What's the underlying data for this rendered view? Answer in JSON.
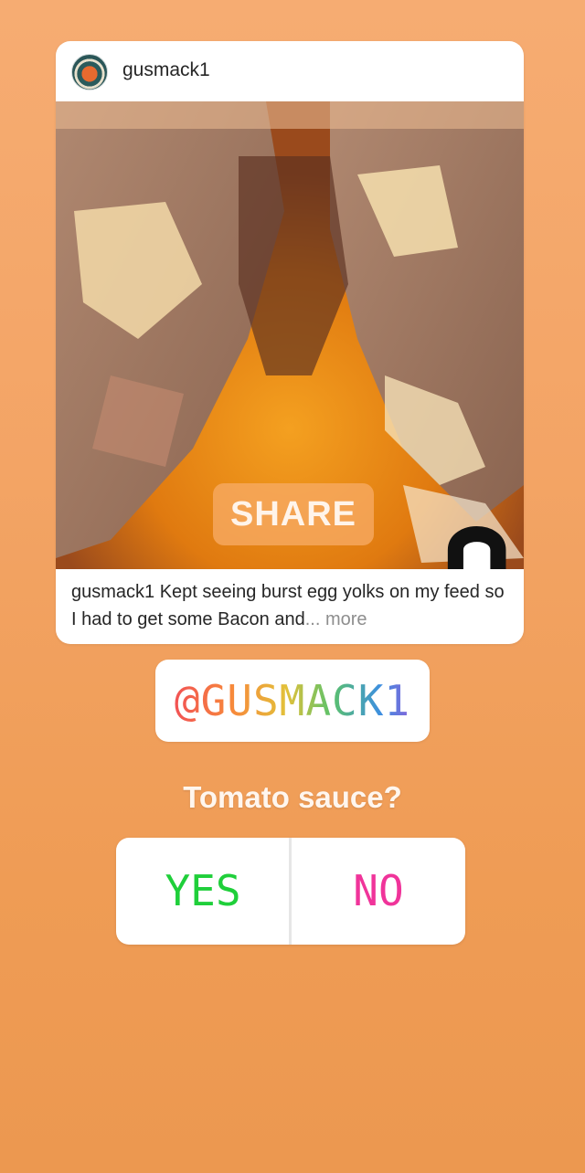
{
  "post": {
    "username": "gusmack1",
    "share_label": "SHARE",
    "caption_user": "gusmack1",
    "caption_text": "Kept seeing burst egg yolks on my feed so I had to get some Bacon and",
    "caption_more": "... more"
  },
  "mention": {
    "text": "@GUSMACK1"
  },
  "poll": {
    "question": "Tomato sauce?",
    "options": [
      "YES",
      "NO"
    ],
    "colors": {
      "yes": "#1fcf3a",
      "no": "#f0349a"
    }
  },
  "icons": {
    "cursor": "hand-pointer-icon",
    "avatar": "profile-avatar"
  }
}
